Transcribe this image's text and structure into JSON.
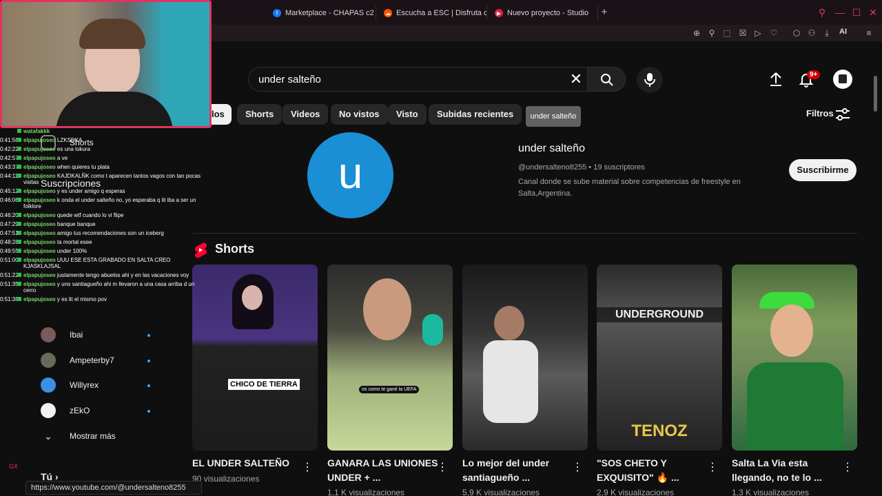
{
  "browser": {
    "tabs": [
      {
        "label": "Marketplace - CHAPAS c2",
        "color": "#1877f2",
        "glyph": "f"
      },
      {
        "label": "Escucha a ESC | Disfruta c",
        "color": "#ff5500",
        "glyph": "☁"
      },
      {
        "label": "Nuevo proyecto - Studio",
        "color": "#e0203a",
        "glyph": "▶"
      }
    ],
    "ai_label": "AI",
    "accent": "#e2335f"
  },
  "search": {
    "query": "under salteño"
  },
  "header": {
    "notif_badge": "9+"
  },
  "chips": [
    "los",
    "Shorts",
    "Videos",
    "No vistos",
    "Visto",
    "Subidas recientes"
  ],
  "tooltip": "under salteño",
  "filters_label": "Filtros",
  "channel": {
    "avatar_letter": "u",
    "name": "under salteño",
    "meta": "@undersalteno8255 • 19 suscriptores",
    "description": "Canal donde se sube material sobre competencias de freestyle en Salta,Argentina.",
    "subscribe_label": "Suscribirme"
  },
  "shorts": {
    "heading": "Shorts",
    "items": [
      {
        "title": "EL UNDER SALTEÑO",
        "views": "90 visualizaciones",
        "caption": "CHICO DE TIERRA"
      },
      {
        "title": "GANARA LAS UNIONES UNDER + ...",
        "views": "1,1 K visualizaciones",
        "caption": "os como te gané la UEFA"
      },
      {
        "title": "Lo mejor del under santiagueño ...",
        "views": "5,9 K visualizaciones",
        "caption": ""
      },
      {
        "title": "\"SOS CHETO Y EXQUISITO\" 🔥 ...",
        "views": "2,9 K visualizaciones",
        "caption": "UNDERGROUND"
      },
      {
        "title": "Salta La Via esta llegando, no te lo ...",
        "views": "1,3 K visualizaciones",
        "caption": ""
      }
    ],
    "overlay_text": "TENOZ"
  },
  "sidebar": {
    "shorts_label": "Shorts",
    "subs_label": "Suscripciones",
    "channels": [
      "Ibai",
      "Ampeterby7",
      "Willyrex",
      "zEkO"
    ],
    "show_more": "Mostrar más",
    "you_label": "Tú"
  },
  "chat": [
    {
      "ts": "",
      "user": "watafakkk",
      "msg": ""
    },
    {
      "ts": "0:41:56",
      "user": "elpapujoseo",
      "msg": "LZKSDKA"
    },
    {
      "ts": "0:42:22",
      "user": "elpapujoseo",
      "msg": "es una lokura"
    },
    {
      "ts": "0:42:57",
      "user": "elpapujoseo",
      "msg": "a ve"
    },
    {
      "ts": "0:43:37",
      "user": "elpapujoseo",
      "msg": "when quieres tu plata"
    },
    {
      "ts": "0:44:11",
      "user": "elpapujoseo",
      "msg": "KAJDKALÑK como t aparecen tantos vagos con tan pocas visitas"
    },
    {
      "ts": "0:45:12",
      "user": "elpapujoseo",
      "msg": "y es under amigo q esperas"
    },
    {
      "ts": "0:46:06",
      "user": "elpapujoseo",
      "msg": "k onda el under salteño no, yo esperaba q lit iba a ser un folklore"
    },
    {
      "ts": "0:46:20",
      "user": "elpapujoseo",
      "msg": "quede wtf cuando lo vi flipe"
    },
    {
      "ts": "0:47:29",
      "user": "elpapujoseo",
      "msg": "banque banque"
    },
    {
      "ts": "0:47:51",
      "user": "elpapujoseo",
      "msg": "amigo tus recomendaciones son un iceberg"
    },
    {
      "ts": "0:48:28",
      "user": "elpapujoseo",
      "msg": "ta mortal esee"
    },
    {
      "ts": "0:49:55",
      "user": "elpapujoseo",
      "msg": "under 100%"
    },
    {
      "ts": "0:51:00",
      "user": "elpapujoseo",
      "msg": "UUU ESE ESTA GRABADO EN SALTA CREO KJASKLAJSAL"
    },
    {
      "ts": "0:51:22",
      "user": "elpapujoseo",
      "msg": "justamente tengo abuelos ahi y en las vacaciones voy"
    },
    {
      "ts": "0:51:35",
      "user": "elpapujoseo",
      "msg": "y uno santiagueño ahi m llevaron a una casa arriba d un cerro"
    },
    {
      "ts": "0:51:38",
      "user": "elpapujoseo",
      "msg": "y es lit el mismo pov"
    }
  ],
  "statusbar_url": "https://www.youtube.com/@undersalteno8255",
  "gx_label": "GX"
}
